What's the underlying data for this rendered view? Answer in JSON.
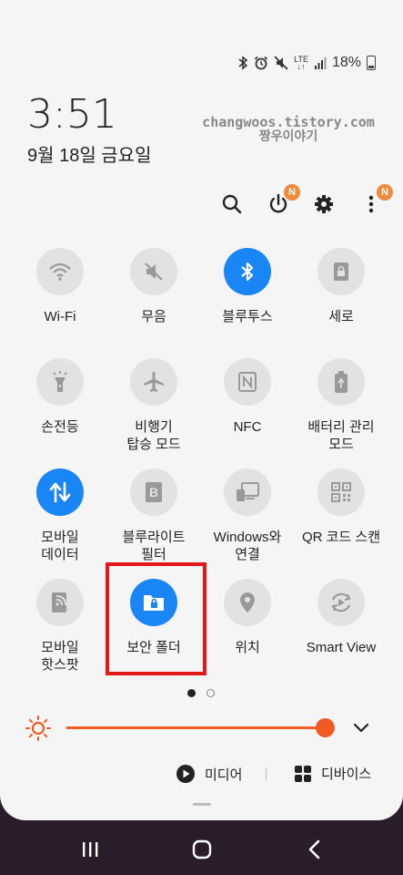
{
  "status": {
    "icons": [
      "bluetooth-icon",
      "alarm-icon",
      "mute-icon",
      "lte-icon",
      "signal-icon"
    ],
    "lte_label": "LTE",
    "battery_pct": "18%"
  },
  "header": {
    "time": "3:51",
    "date": "9월 18일 금요일",
    "watermark_line1": "changwoos.tistory.com",
    "watermark_line2": "짱우이야기"
  },
  "top_actions": {
    "power_badge": "N",
    "more_badge": "N"
  },
  "tiles": [
    {
      "label": "Wi-Fi",
      "icon": "wifi-icon",
      "on": false
    },
    {
      "label": "무음",
      "icon": "mute-icon",
      "on": false
    },
    {
      "label": "블루투스",
      "icon": "bluetooth-icon",
      "on": true
    },
    {
      "label": "세로",
      "icon": "rotation-lock-icon",
      "on": false
    },
    {
      "label": "손전등",
      "icon": "flashlight-icon",
      "on": false
    },
    {
      "label": "비행기\n탑승 모드",
      "icon": "airplane-icon",
      "on": false
    },
    {
      "label": "NFC",
      "icon": "nfc-icon",
      "on": false
    },
    {
      "label": "배터리 관리\n모드",
      "icon": "battery-saver-icon",
      "on": false
    },
    {
      "label": "모바일\n데이터",
      "icon": "mobile-data-icon",
      "on": true
    },
    {
      "label": "블루라이트\n필터",
      "icon": "blue-light-filter-icon",
      "on": false
    },
    {
      "label": "Windows와\n연결",
      "icon": "link-to-windows-icon",
      "on": false
    },
    {
      "label": "QR 코드 스캔",
      "icon": "qr-code-icon",
      "on": false
    },
    {
      "label": "모바일\n핫스팟",
      "icon": "hotspot-icon",
      "on": false
    },
    {
      "label": "보안 폴더",
      "icon": "secure-folder-icon",
      "on": true
    },
    {
      "label": "위치",
      "icon": "location-icon",
      "on": false
    },
    {
      "label": "Smart View",
      "icon": "smart-view-icon",
      "on": false
    }
  ],
  "pager": {
    "pages": 2,
    "current": 1
  },
  "brightness": {
    "level_pct": 92,
    "accent": "#f15a24"
  },
  "media": {
    "media_label": "미디어",
    "devices_label": "디바이스"
  },
  "colors": {
    "tile_on": "#1a86f5",
    "highlight": "#e41818",
    "badge": "#f08a3c"
  }
}
